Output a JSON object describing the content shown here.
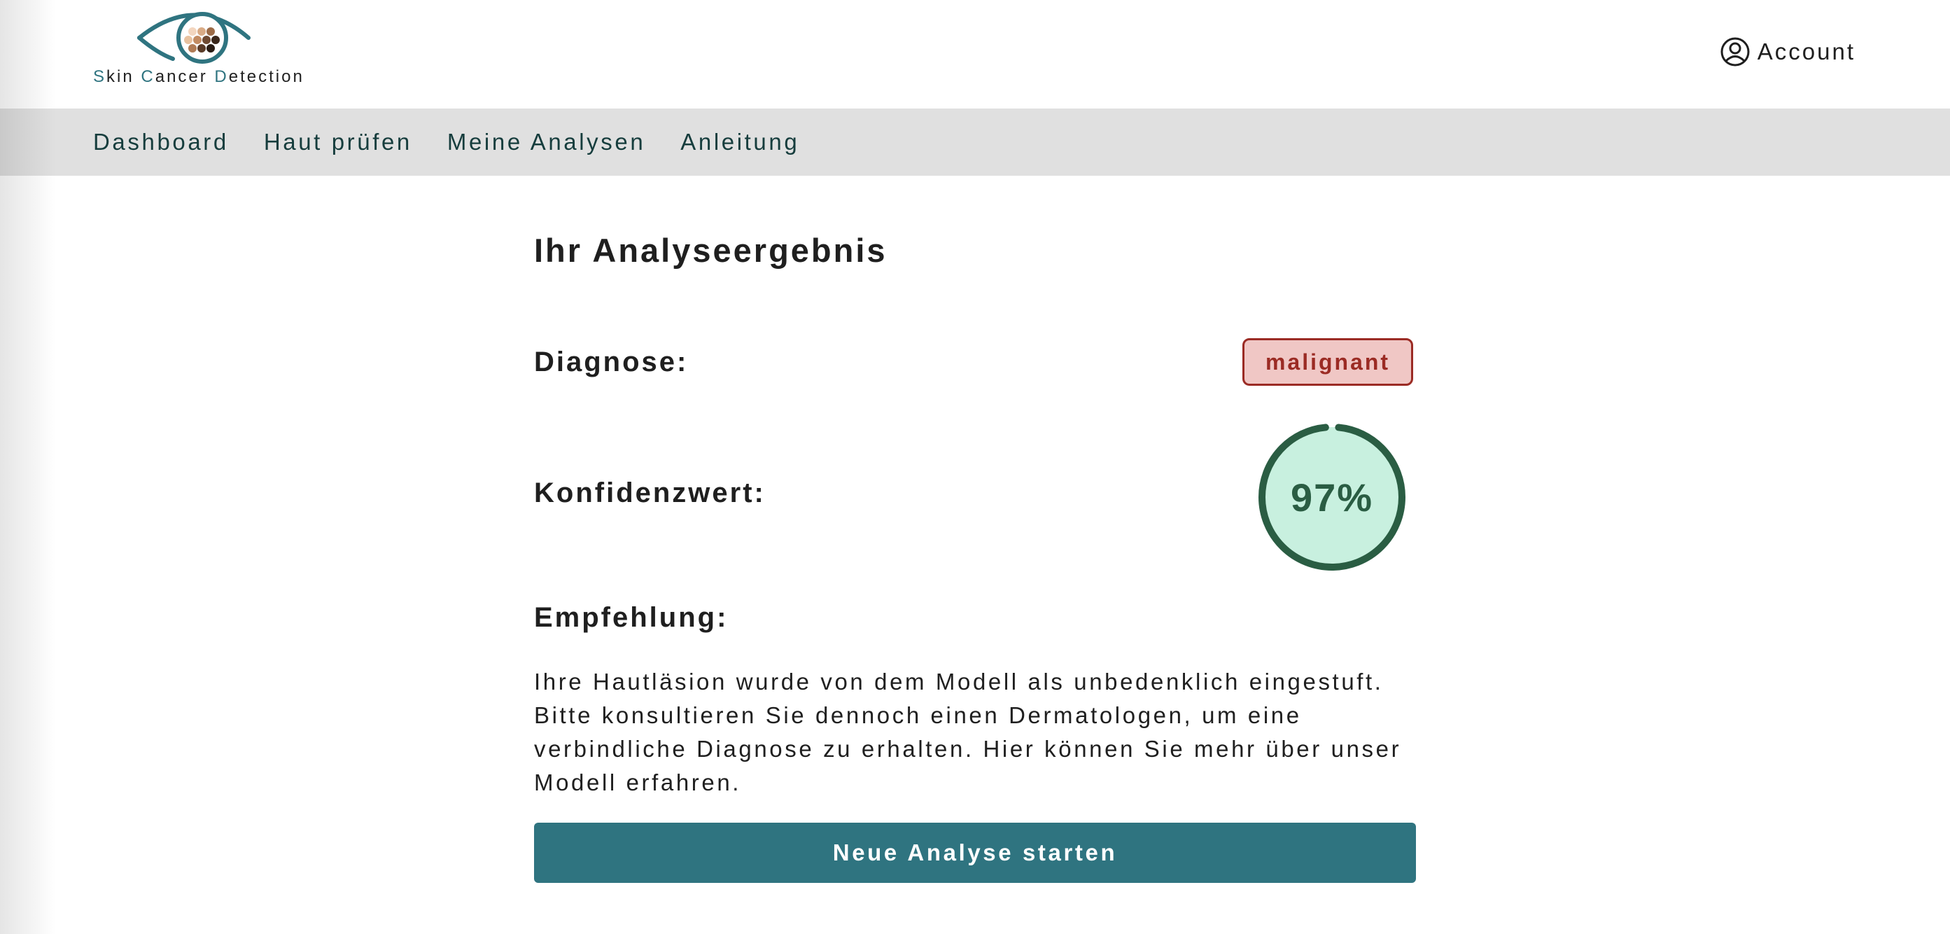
{
  "brand": {
    "name_parts": [
      {
        "text": "S",
        "highlight": true
      },
      {
        "text": "kin ",
        "highlight": false
      },
      {
        "text": "C",
        "highlight": true
      },
      {
        "text": "ancer ",
        "highlight": false
      },
      {
        "text": "D",
        "highlight": true
      },
      {
        "text": "etection",
        "highlight": false
      }
    ],
    "logo_icon": "eye-icon"
  },
  "header": {
    "account_label": "Account",
    "account_icon": "user-circle-icon"
  },
  "nav": {
    "items": [
      {
        "label": "Dashboard"
      },
      {
        "label": "Haut prüfen"
      },
      {
        "label": "Meine Analysen"
      },
      {
        "label": "Anleitung"
      }
    ]
  },
  "result": {
    "title": "Ihr Analyseergebnis",
    "diagnosis_label": "Diagnose:",
    "diagnosis_value": "malignant",
    "confidence_label": "Konfidenzwert:",
    "confidence_value": "97%",
    "confidence_fraction": 0.97,
    "recommendation_label": "Empfehlung:",
    "recommendation_text": "Ihre Hautläsion wurde von dem Modell als unbedenklich eingestuft. Bitte konsultieren Sie dennoch einen Dermatologen, um eine verbindliche Diagnose zu erhalten. Hier können Sie mehr über unser Modell erfahren.",
    "cta_label": "Neue Analyse starten"
  },
  "colors": {
    "accent": "#2f7480",
    "nav_bg": "#e0e0e0",
    "badge_bg": "#f0c7c5",
    "badge_text": "#9b2b24",
    "gauge_fill": "#c8f0df",
    "gauge_ring": "#2a5d43"
  }
}
